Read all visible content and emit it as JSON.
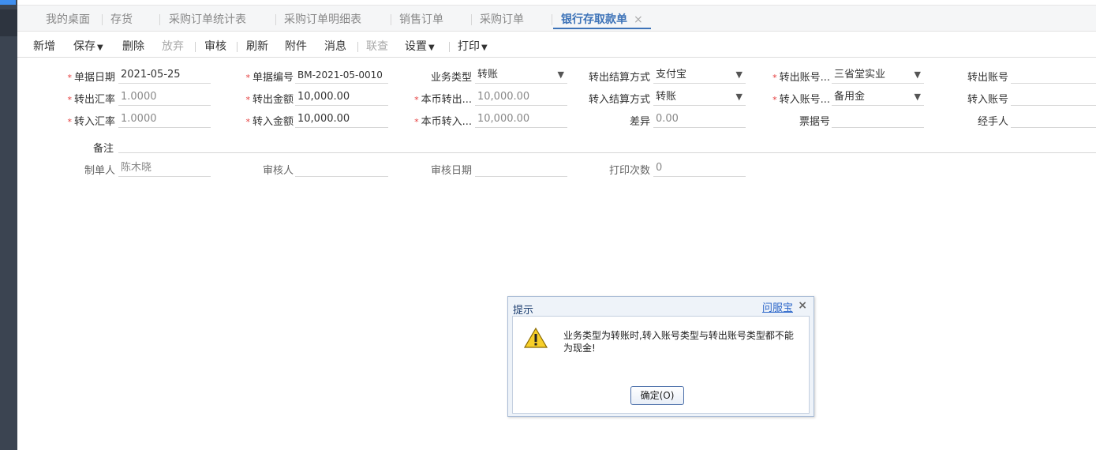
{
  "tabs": [
    {
      "label": "我的桌面"
    },
    {
      "label": "存货"
    },
    {
      "label": "采购订单统计表"
    },
    {
      "label": "采购订单明细表"
    },
    {
      "label": "销售订单"
    },
    {
      "label": "采购订单"
    },
    {
      "label": "银行存取款单",
      "close": "×"
    }
  ],
  "toolbar": {
    "add": "新增",
    "save": "保存",
    "delete": "删除",
    "discard": "放弃",
    "audit": "审核",
    "refresh": "刷新",
    "attach": "附件",
    "message": "消息",
    "query": "联查",
    "settings": "设置",
    "print": "打印"
  },
  "form": {
    "doc_date": {
      "label": "单据日期",
      "value": "2021-05-25"
    },
    "doc_no": {
      "label": "单据编号",
      "value": "BM-2021-05-0010"
    },
    "biz_type": {
      "label": "业务类型",
      "value": "转账"
    },
    "out_settle": {
      "label": "转出结算方式",
      "value": "支付宝"
    },
    "out_acct_name": {
      "label": "转出账号...",
      "value": "三省堂实业"
    },
    "out_acct_no": {
      "label": "转出账号",
      "value": ""
    },
    "out_rate": {
      "label": "转出汇率",
      "value": "1.0000"
    },
    "out_amount": {
      "label": "转出金额",
      "value": "10,000.00"
    },
    "local_out": {
      "label": "本币转出...",
      "value": "10,000.00"
    },
    "in_settle": {
      "label": "转入结算方式",
      "value": "转账"
    },
    "in_acct_name": {
      "label": "转入账号...",
      "value": "备用金"
    },
    "in_acct_no": {
      "label": "转入账号",
      "value": ""
    },
    "in_rate": {
      "label": "转入汇率",
      "value": "1.0000"
    },
    "in_amount": {
      "label": "转入金额",
      "value": "10,000.00"
    },
    "local_in": {
      "label": "本币转入...",
      "value": "10,000.00"
    },
    "diff": {
      "label": "差异",
      "value": "0.00"
    },
    "bill_no": {
      "label": "票据号",
      "value": ""
    },
    "handler": {
      "label": "经手人",
      "value": ""
    },
    "remark": {
      "label": "备注",
      "value": ""
    },
    "maker": {
      "label": "制单人",
      "value": "陈木晓"
    },
    "auditor": {
      "label": "审核人",
      "value": ""
    },
    "audit_date": {
      "label": "审核日期",
      "value": ""
    },
    "print_count": {
      "label": "打印次数",
      "value": "0"
    }
  },
  "dialog": {
    "title": "提示",
    "brand": "问服宝",
    "close": "×",
    "message": "业务类型为转账时,转入账号类型与转出账号类型都不能为现金!",
    "ok": "确定(O)"
  },
  "colors": {
    "accent": "#3d73b8",
    "required": "#e53c3c",
    "sidebar": "#3b4451"
  }
}
